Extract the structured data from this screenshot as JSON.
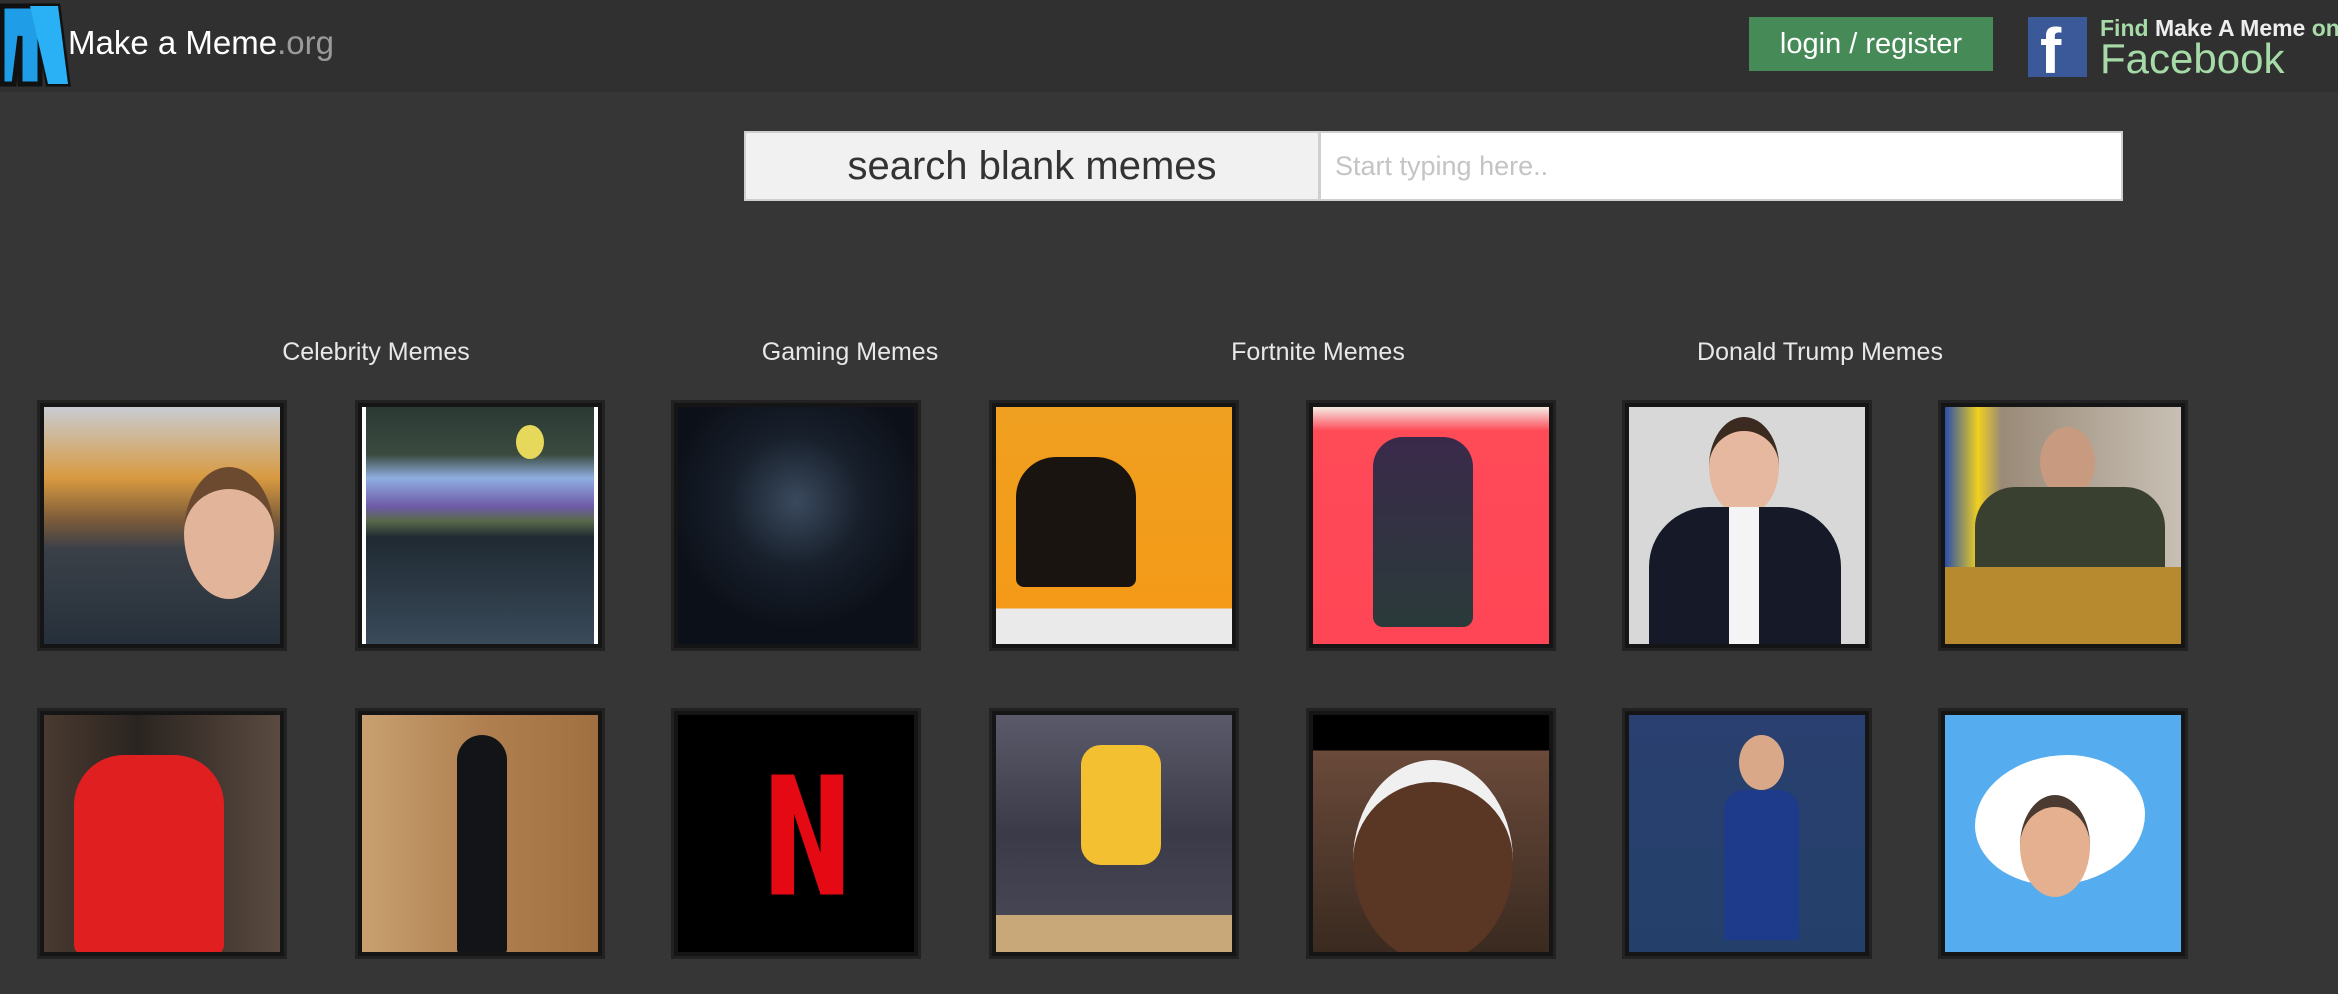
{
  "header": {
    "brand_name": "Make a Meme",
    "brand_tld": ".org",
    "login_label": "login / register",
    "facebook_banner": {
      "line1_a": "Find ",
      "line1_b": "Make A Meme",
      "line1_c": " on",
      "line2": "Facebook"
    }
  },
  "search": {
    "label": "search blank memes",
    "placeholder": "Start typing here..",
    "value": ""
  },
  "categories": [
    {
      "label": "Celebrity Memes"
    },
    {
      "label": "Gaming Memes"
    },
    {
      "label": "Fortnite Memes"
    },
    {
      "label": "Donald Trump Memes"
    }
  ],
  "colors": {
    "login_bg": "#458a57",
    "facebook_blue": "#3b5998",
    "page_bg": "#363636"
  }
}
